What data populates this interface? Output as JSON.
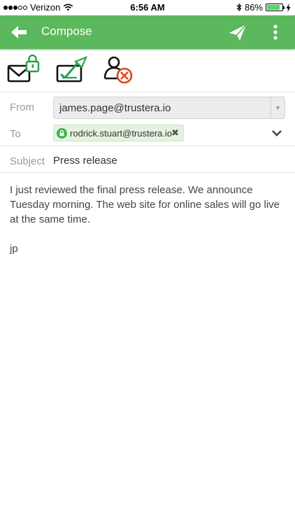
{
  "status_bar": {
    "carrier": "Verizon",
    "time": "6:56 AM",
    "battery": "86%",
    "battery_level": 0.86
  },
  "toolbar": {
    "title": "Compose",
    "icons": {
      "back": "back-arrow-icon",
      "send": "send-icon",
      "more": "more-vert-icon"
    }
  },
  "actions": {
    "icons": [
      "encrypt-mail-icon",
      "sign-mail-icon",
      "remove-recipient-key-icon"
    ]
  },
  "from": {
    "label": "From",
    "value": "james.page@trustera.io"
  },
  "to": {
    "label": "To",
    "recipients": [
      "rodrick.stuart@trustera.io"
    ],
    "remove_symbol": "✖"
  },
  "subject": {
    "label": "Subject",
    "value": "Press release"
  },
  "body": {
    "paragraphs": [
      "I just reviewed the final press release. We announce Tuesday morning. The web site for online sales will go live at the same time.",
      "jp"
    ]
  },
  "colors": {
    "accent": "#5cb85c",
    "accent_dark": "#27a04a",
    "warning": "#e0441b",
    "chip_bg": "#e3f3df"
  }
}
